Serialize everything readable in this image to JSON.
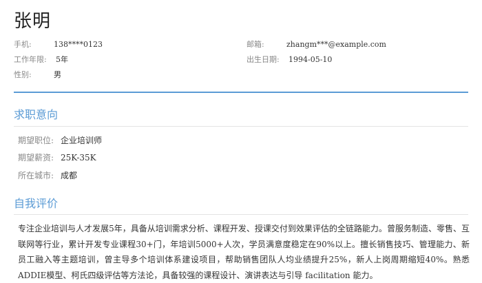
{
  "header": {
    "name": "张明"
  },
  "basic_info": {
    "phone_label": "手机:",
    "phone_value": "138****0123",
    "email_label": "邮箱:",
    "email_value": "zhangm***@example.com",
    "experience_label": "工作年限:",
    "experience_value": "5年",
    "birth_label": "出生日期:",
    "birth_value": "1994-05-10",
    "gender_label": "性别:",
    "gender_value": "男"
  },
  "job_intent": {
    "title": "求职意向",
    "position_label": "期望职位:",
    "position_value": "企业培训师",
    "salary_label": "期望薪资:",
    "salary_value": "25K-35K",
    "city_label": "所在城市:",
    "city_value": "成都"
  },
  "self_evaluation": {
    "title": "自我评价",
    "text": "专注企业培训与人才发展5年，具备从培训需求分析、课程开发、授课交付到效果评估的全链路能力。曾服务制造、零售、互联网等行业，累计开发专业课程30+门，年培训5000+人次，学员满意度稳定在90%以上。擅长销售技巧、管理能力、新员工融入等主题培训，曾主导多个培训体系建设项目，帮助销售团队人均业绩提升25%，新人上岗周期缩短40%。熟悉ADDIE模型、柯氏四级评估等方法论，具备较强的课程设计、演讲表达与引导 facilitation 能力。"
  }
}
